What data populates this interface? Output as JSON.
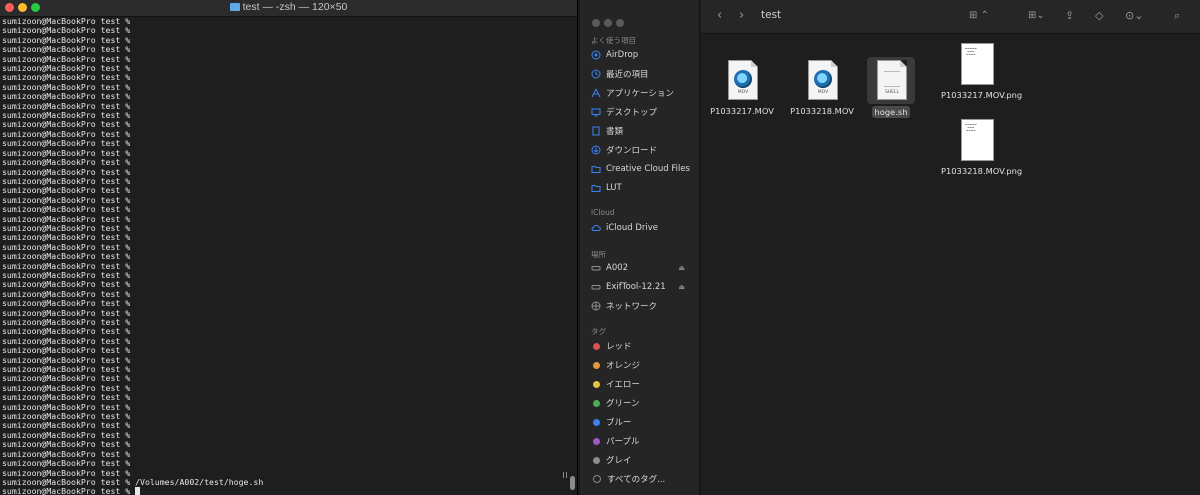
{
  "terminal": {
    "title": "test — -zsh — 120×50",
    "prompt": "sumizoon@MacBookPro test %",
    "empty_prompt_count": 49,
    "last_command_line": "sumizoon@MacBookPro test % /Volumes/A002/test/hoge.sh",
    "final_prompt": "sumizoon@MacBookPro test %"
  },
  "finder": {
    "toolbar": {
      "title": "test"
    },
    "sidebar": {
      "favorites_label": "よく使う項目",
      "favorites": [
        {
          "label": "AirDrop",
          "icon": "airdrop-icon"
        },
        {
          "label": "最近の項目",
          "icon": "clock-icon"
        },
        {
          "label": "アプリケーション",
          "icon": "applications-icon"
        },
        {
          "label": "デスクトップ",
          "icon": "desktop-icon"
        },
        {
          "label": "書類",
          "icon": "document-icon"
        },
        {
          "label": "ダウンロード",
          "icon": "download-icon"
        },
        {
          "label": "Creative Cloud Files",
          "icon": "folder-icon"
        },
        {
          "label": "LUT",
          "icon": "folder-icon"
        }
      ],
      "icloud_label": "iCloud",
      "icloud": [
        {
          "label": "iCloud Drive",
          "icon": "cloud-icon"
        }
      ],
      "locations_label": "場所",
      "locations": [
        {
          "label": "A002",
          "icon": "drive-icon"
        },
        {
          "label": "ExifTool-12.21",
          "icon": "drive-icon"
        },
        {
          "label": "ネットワーク",
          "icon": "network-icon"
        }
      ],
      "tags_label": "タグ",
      "tags": [
        {
          "label": "レッド",
          "color": "#d9534f"
        },
        {
          "label": "オレンジ",
          "color": "#e8943a"
        },
        {
          "label": "イエロー",
          "color": "#e2c53c"
        },
        {
          "label": "グリーン",
          "color": "#4cb050"
        },
        {
          "label": "ブルー",
          "color": "#3b82f6"
        },
        {
          "label": "パープル",
          "color": "#a058c8"
        },
        {
          "label": "グレイ",
          "color": "#8e8e8e"
        },
        {
          "label": "すべてのタグ...",
          "color": ""
        }
      ]
    },
    "files": [
      {
        "name": "P1033217.MOV",
        "type": "mov",
        "badge": "MOV"
      },
      {
        "name": "P1033218.MOV",
        "type": "mov",
        "badge": "MOV"
      },
      {
        "name": "hoge.sh",
        "type": "shell",
        "badge": "SHELL"
      },
      {
        "name": "P1033217.MOV.png",
        "type": "png"
      },
      {
        "name": "P1033218.MOV.png",
        "type": "png"
      }
    ]
  }
}
